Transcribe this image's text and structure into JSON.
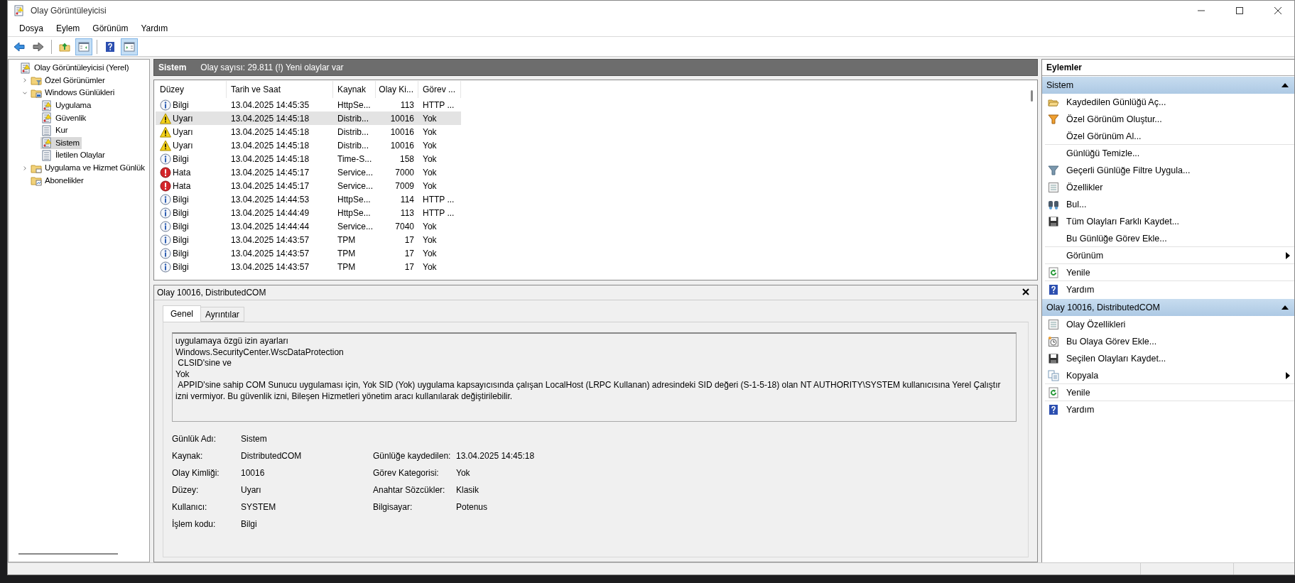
{
  "window": {
    "title": "Olay Görüntüleyicisi"
  },
  "menu": [
    "Dosya",
    "Eylem",
    "Görünüm",
    "Yardım"
  ],
  "toolbar": [
    [
      {
        "kind": "back",
        "pressed": false
      },
      {
        "kind": "forward",
        "pressed": false
      }
    ],
    [
      {
        "kind": "up",
        "pressed": false
      },
      {
        "kind": "tree",
        "pressed": true
      }
    ],
    [
      {
        "kind": "help",
        "pressed": false
      },
      {
        "kind": "actions",
        "pressed": true
      }
    ]
  ],
  "tree": [
    {
      "label": "Olay Görüntüleyicisi (Yerel)",
      "kind": "log",
      "selected": false,
      "children": [
        {
          "label": "Özel Görünümler",
          "kind": "folder-filter",
          "expanded": false,
          "selected": false
        },
        {
          "label": "Windows Günlükleri",
          "kind": "folder-windows",
          "expanded": true,
          "selected": false,
          "children": [
            {
              "label": "Uygulama",
              "kind": "log",
              "selected": false
            },
            {
              "label": "Güvenlik",
              "kind": "log",
              "selected": false
            },
            {
              "label": "Kur",
              "kind": "page",
              "selected": false
            },
            {
              "label": "Sistem",
              "kind": "log",
              "selected": true
            },
            {
              "label": "İletilen Olaylar",
              "kind": "page",
              "selected": false
            }
          ]
        },
        {
          "label": "Uygulama ve Hizmet Günlük",
          "kind": "folder",
          "expanded": false,
          "selected": false
        },
        {
          "label": "Abonelikler",
          "kind": "folder-sub",
          "selected": false
        }
      ]
    }
  ],
  "log_header": {
    "name": "Sistem",
    "info": "Olay sayısı: 29.811 (!) Yeni olaylar var"
  },
  "table": {
    "columns": [
      "Düzey",
      "Tarih ve Saat",
      "Kaynak",
      "Olay Ki...",
      "Görev ..."
    ],
    "rows": [
      {
        "kind": "info",
        "level": "Bilgi",
        "date": "13.04.2025 14:45:35",
        "source": "HttpSe...",
        "id": "113",
        "task": "HTTP ...",
        "selected": false
      },
      {
        "kind": "warning",
        "level": "Uyarı",
        "date": "13.04.2025 14:45:18",
        "source": "Distrib...",
        "id": "10016",
        "task": "Yok",
        "selected": true
      },
      {
        "kind": "warning",
        "level": "Uyarı",
        "date": "13.04.2025 14:45:18",
        "source": "Distrib...",
        "id": "10016",
        "task": "Yok",
        "selected": false
      },
      {
        "kind": "warning",
        "level": "Uyarı",
        "date": "13.04.2025 14:45:18",
        "source": "Distrib...",
        "id": "10016",
        "task": "Yok",
        "selected": false
      },
      {
        "kind": "info",
        "level": "Bilgi",
        "date": "13.04.2025 14:45:18",
        "source": "Time-S...",
        "id": "158",
        "task": "Yok",
        "selected": false
      },
      {
        "kind": "error",
        "level": "Hata",
        "date": "13.04.2025 14:45:17",
        "source": "Service...",
        "id": "7000",
        "task": "Yok",
        "selected": false
      },
      {
        "kind": "error",
        "level": "Hata",
        "date": "13.04.2025 14:45:17",
        "source": "Service...",
        "id": "7009",
        "task": "Yok",
        "selected": false
      },
      {
        "kind": "info",
        "level": "Bilgi",
        "date": "13.04.2025 14:44:53",
        "source": "HttpSe...",
        "id": "114",
        "task": "HTTP ...",
        "selected": false
      },
      {
        "kind": "info",
        "level": "Bilgi",
        "date": "13.04.2025 14:44:49",
        "source": "HttpSe...",
        "id": "113",
        "task": "HTTP ...",
        "selected": false
      },
      {
        "kind": "info",
        "level": "Bilgi",
        "date": "13.04.2025 14:44:44",
        "source": "Service...",
        "id": "7040",
        "task": "Yok",
        "selected": false
      },
      {
        "kind": "info",
        "level": "Bilgi",
        "date": "13.04.2025 14:43:57",
        "source": "TPM",
        "id": "17",
        "task": "Yok",
        "selected": false
      },
      {
        "kind": "info",
        "level": "Bilgi",
        "date": "13.04.2025 14:43:57",
        "source": "TPM",
        "id": "17",
        "task": "Yok",
        "selected": false
      },
      {
        "kind": "info",
        "level": "Bilgi",
        "date": "13.04.2025 14:43:57",
        "source": "TPM",
        "id": "17",
        "task": "Yok",
        "selected": false
      }
    ]
  },
  "detail": {
    "title": "Olay 10016, DistributedCOM",
    "tabs": [
      {
        "label": "Genel",
        "selected": true
      },
      {
        "label": "Ayrıntılar",
        "selected": false
      }
    ],
    "message": "uygulamaya özgü izin ayarları\nWindows.SecurityCenter.WscDataProtection\n CLSID'sine ve\nYok\n APPID'sine sahip COM Sunucu uygulaması için, Yok SID (Yok) uygulama kapsayıcısında çalışan LocalHost (LRPC Kullanan) adresindeki SID değeri (S-1-5-18) olan NT AUTHORITY\\SYSTEM kullanıcısına Yerel Çalıştır izni vermiyor. Bu güvenlik izni, Bileşen Hizmetleri yönetim aracı kullanılarak değiştirilebilir.",
    "fields": [
      [
        {
          "label": "Günlük Adı:",
          "value": "Sistem"
        }
      ],
      [
        {
          "label": "Kaynak:",
          "value": "DistributedCOM"
        },
        {
          "label": "Günlüğe kaydedilen:",
          "value": "13.04.2025 14:45:18"
        }
      ],
      [
        {
          "label": "Olay Kimliği:",
          "value": "10016"
        },
        {
          "label": "Görev Kategorisi:",
          "value": "Yok"
        }
      ],
      [
        {
          "label": "Düzey:",
          "value": "Uyarı"
        },
        {
          "label": "Anahtar Sözcükler:",
          "value": "Klasik"
        }
      ],
      [
        {
          "label": "Kullanıcı:",
          "value": "SYSTEM"
        },
        {
          "label": "Bilgisayar:",
          "value": "Potenus"
        }
      ],
      [
        {
          "label": "İşlem kodu:",
          "value": "Bilgi"
        }
      ]
    ]
  },
  "actions": {
    "title": "Eylemler",
    "sections": [
      {
        "title": "Sistem",
        "expanded": true,
        "items": [
          {
            "label": "Kaydedilen Günlüğü Aç...",
            "kind": "open",
            "submenu": false,
            "divider": false
          },
          {
            "label": "Özel Görünüm Oluştur...",
            "kind": "filter-color",
            "submenu": false,
            "divider": false
          },
          {
            "label": "Özel Görünüm Al...",
            "kind": "none",
            "submenu": false,
            "divider": true
          },
          {
            "label": "Günlüğü Temizle...",
            "kind": "none",
            "submenu": false,
            "divider": false
          },
          {
            "label": "Geçerli Günlüğe Filtre Uygula...",
            "kind": "filter",
            "submenu": false,
            "divider": false
          },
          {
            "label": "Özellikler",
            "kind": "props",
            "submenu": false,
            "divider": false
          },
          {
            "label": "Bul...",
            "kind": "find",
            "submenu": false,
            "divider": false
          },
          {
            "label": "Tüm Olayları Farklı Kaydet...",
            "kind": "save",
            "submenu": false,
            "divider": false
          },
          {
            "label": "Bu Günlüğe Görev Ekle...",
            "kind": "none",
            "submenu": false,
            "divider": true
          },
          {
            "label": "Görünüm",
            "kind": "none",
            "submenu": true,
            "divider": true
          },
          {
            "label": "Yenile",
            "kind": "refresh",
            "submenu": false,
            "divider": true
          },
          {
            "label": "Yardım",
            "kind": "help",
            "submenu": false,
            "divider": false
          }
        ]
      },
      {
        "title": "Olay 10016, DistributedCOM",
        "expanded": true,
        "items": [
          {
            "label": "Olay Özellikleri",
            "kind": "props",
            "submenu": false,
            "divider": false
          },
          {
            "label": "Bu Olaya Görev Ekle...",
            "kind": "task",
            "submenu": false,
            "divider": false
          },
          {
            "label": "Seçilen Olayları Kaydet...",
            "kind": "save",
            "submenu": false,
            "divider": false
          },
          {
            "label": "Kopyala",
            "kind": "copy",
            "submenu": true,
            "divider": true
          },
          {
            "label": "Yenile",
            "kind": "refresh",
            "submenu": false,
            "divider": true
          },
          {
            "label": "Yardım",
            "kind": "help",
            "submenu": false,
            "divider": false
          }
        ]
      }
    ]
  }
}
